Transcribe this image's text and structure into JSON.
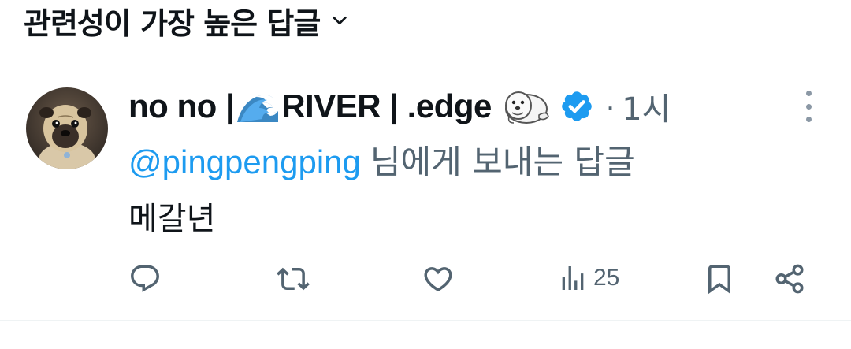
{
  "header": {
    "sort_label": "관련성이 가장 높은 답글",
    "chevron_icon": "chevron-down-icon"
  },
  "tweet": {
    "author": {
      "name_part1": "no no | ",
      "name_part2": "RIVER | .edge",
      "emoji_1": "water-wave-emoji",
      "emoji_2": "seal-emoji",
      "verified": true,
      "verified_color": "#1d9bf0"
    },
    "separator": "·",
    "time": "1시",
    "reply_to": {
      "handle": "@pingpengping",
      "suffix": "님에게 보내는 답글"
    },
    "text": "메갈년",
    "actions": {
      "reply_icon": "reply-icon",
      "retweet_icon": "retweet-icon",
      "like_icon": "heart-icon",
      "views_icon": "views-icon",
      "views_count": "25",
      "bookmark_icon": "bookmark-icon",
      "share_icon": "share-icon"
    }
  },
  "colors": {
    "text": "#0f1419",
    "secondary": "#536471",
    "accent": "#1d9bf0",
    "divider": "#eff3f4"
  }
}
